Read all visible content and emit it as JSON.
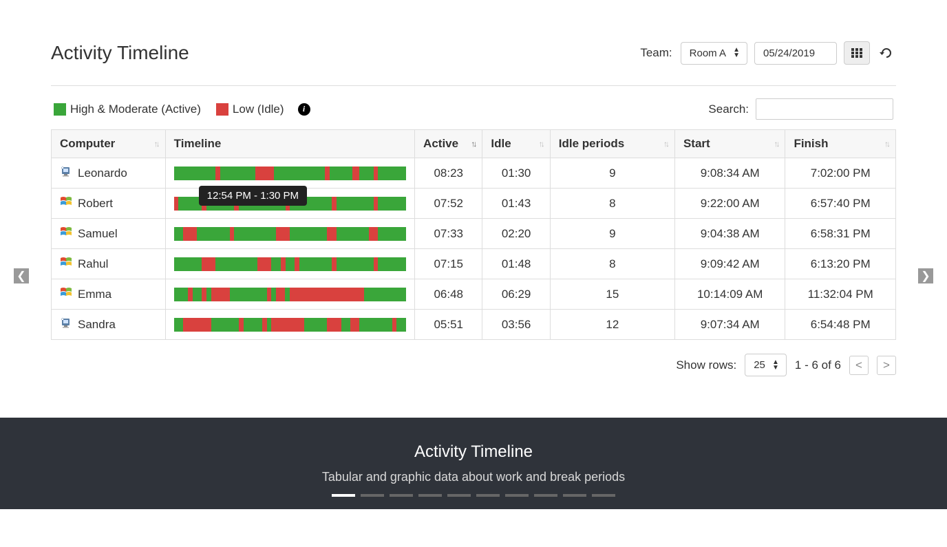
{
  "header": {
    "title": "Activity Timeline",
    "team_label": "Team:",
    "team_value": "Room A",
    "date_value": "05/24/2019"
  },
  "legend": {
    "active_label": "High & Moderate (Active)",
    "idle_label": "Low (Idle)"
  },
  "search": {
    "label": "Search:",
    "value": ""
  },
  "columns": {
    "computer": "Computer",
    "timeline": "Timeline",
    "active": "Active",
    "idle": "Idle",
    "idle_periods": "Idle periods",
    "start": "Start",
    "finish": "Finish"
  },
  "tooltip": "12:54 PM - 1:30 PM",
  "rows": [
    {
      "os": "mac",
      "name": "Leonardo",
      "active": "08:23",
      "idle": "01:30",
      "idle_periods": "9",
      "start": "9:08:34 AM",
      "finish": "7:02:00 PM",
      "segments": [
        [
          "g",
          18
        ],
        [
          "r",
          2
        ],
        [
          "g",
          15
        ],
        [
          "r",
          8
        ],
        [
          "g",
          22
        ],
        [
          "r",
          2
        ],
        [
          "g",
          10
        ],
        [
          "r",
          3
        ],
        [
          "g",
          6
        ],
        [
          "r",
          2
        ],
        [
          "g",
          12
        ]
      ]
    },
    {
      "os": "win",
      "name": "Robert",
      "active": "07:52",
      "idle": "01:43",
      "idle_periods": "8",
      "start": "9:22:00 AM",
      "finish": "6:57:40 PM",
      "segments": [
        [
          "r",
          2
        ],
        [
          "g",
          10
        ],
        [
          "r",
          2
        ],
        [
          "g",
          12
        ],
        [
          "r",
          2
        ],
        [
          "g",
          20
        ],
        [
          "r",
          2
        ],
        [
          "g",
          18
        ],
        [
          "r",
          2
        ],
        [
          "g",
          16
        ],
        [
          "r",
          2
        ],
        [
          "g",
          12
        ]
      ]
    },
    {
      "os": "win",
      "name": "Samuel",
      "active": "07:33",
      "idle": "02:20",
      "idle_periods": "9",
      "start": "9:04:38 AM",
      "finish": "6:58:31 PM",
      "segments": [
        [
          "g",
          4
        ],
        [
          "r",
          6
        ],
        [
          "g",
          14
        ],
        [
          "r",
          2
        ],
        [
          "g",
          18
        ],
        [
          "r",
          6
        ],
        [
          "g",
          16
        ],
        [
          "r",
          4
        ],
        [
          "g",
          14
        ],
        [
          "r",
          4
        ],
        [
          "g",
          12
        ]
      ]
    },
    {
      "os": "win",
      "name": "Rahul",
      "active": "07:15",
      "idle": "01:48",
      "idle_periods": "8",
      "start": "9:09:42 AM",
      "finish": "6:13:20 PM",
      "segments": [
        [
          "g",
          12
        ],
        [
          "r",
          6
        ],
        [
          "g",
          18
        ],
        [
          "r",
          6
        ],
        [
          "g",
          4
        ],
        [
          "r",
          2
        ],
        [
          "g",
          4
        ],
        [
          "r",
          2
        ],
        [
          "g",
          14
        ],
        [
          "r",
          2
        ],
        [
          "g",
          16
        ],
        [
          "r",
          2
        ],
        [
          "g",
          12
        ]
      ]
    },
    {
      "os": "win",
      "name": "Emma",
      "active": "06:48",
      "idle": "06:29",
      "idle_periods": "15",
      "start": "10:14:09 AM",
      "finish": "11:32:04 PM",
      "segments": [
        [
          "g",
          6
        ],
        [
          "r",
          2
        ],
        [
          "g",
          4
        ],
        [
          "r",
          2
        ],
        [
          "g",
          2
        ],
        [
          "r",
          8
        ],
        [
          "g",
          16
        ],
        [
          "r",
          2
        ],
        [
          "g",
          2
        ],
        [
          "r",
          4
        ],
        [
          "g",
          2
        ],
        [
          "r",
          32
        ],
        [
          "g",
          18
        ]
      ]
    },
    {
      "os": "mac",
      "name": "Sandra",
      "active": "05:51",
      "idle": "03:56",
      "idle_periods": "12",
      "start": "9:07:34 AM",
      "finish": "6:54:48 PM",
      "segments": [
        [
          "g",
          4
        ],
        [
          "r",
          12
        ],
        [
          "g",
          12
        ],
        [
          "r",
          2
        ],
        [
          "g",
          8
        ],
        [
          "r",
          2
        ],
        [
          "g",
          2
        ],
        [
          "r",
          14
        ],
        [
          "g",
          10
        ],
        [
          "r",
          6
        ],
        [
          "g",
          4
        ],
        [
          "r",
          4
        ],
        [
          "g",
          14
        ],
        [
          "r",
          2
        ],
        [
          "g",
          4
        ]
      ]
    }
  ],
  "footer": {
    "show_rows_label": "Show rows:",
    "show_rows_value": "25",
    "range": "1 - 6 of 6"
  },
  "banner": {
    "title": "Activity Timeline",
    "subtitle": "Tabular and graphic data about work and break periods",
    "dots": 10,
    "active_dot": 0
  }
}
